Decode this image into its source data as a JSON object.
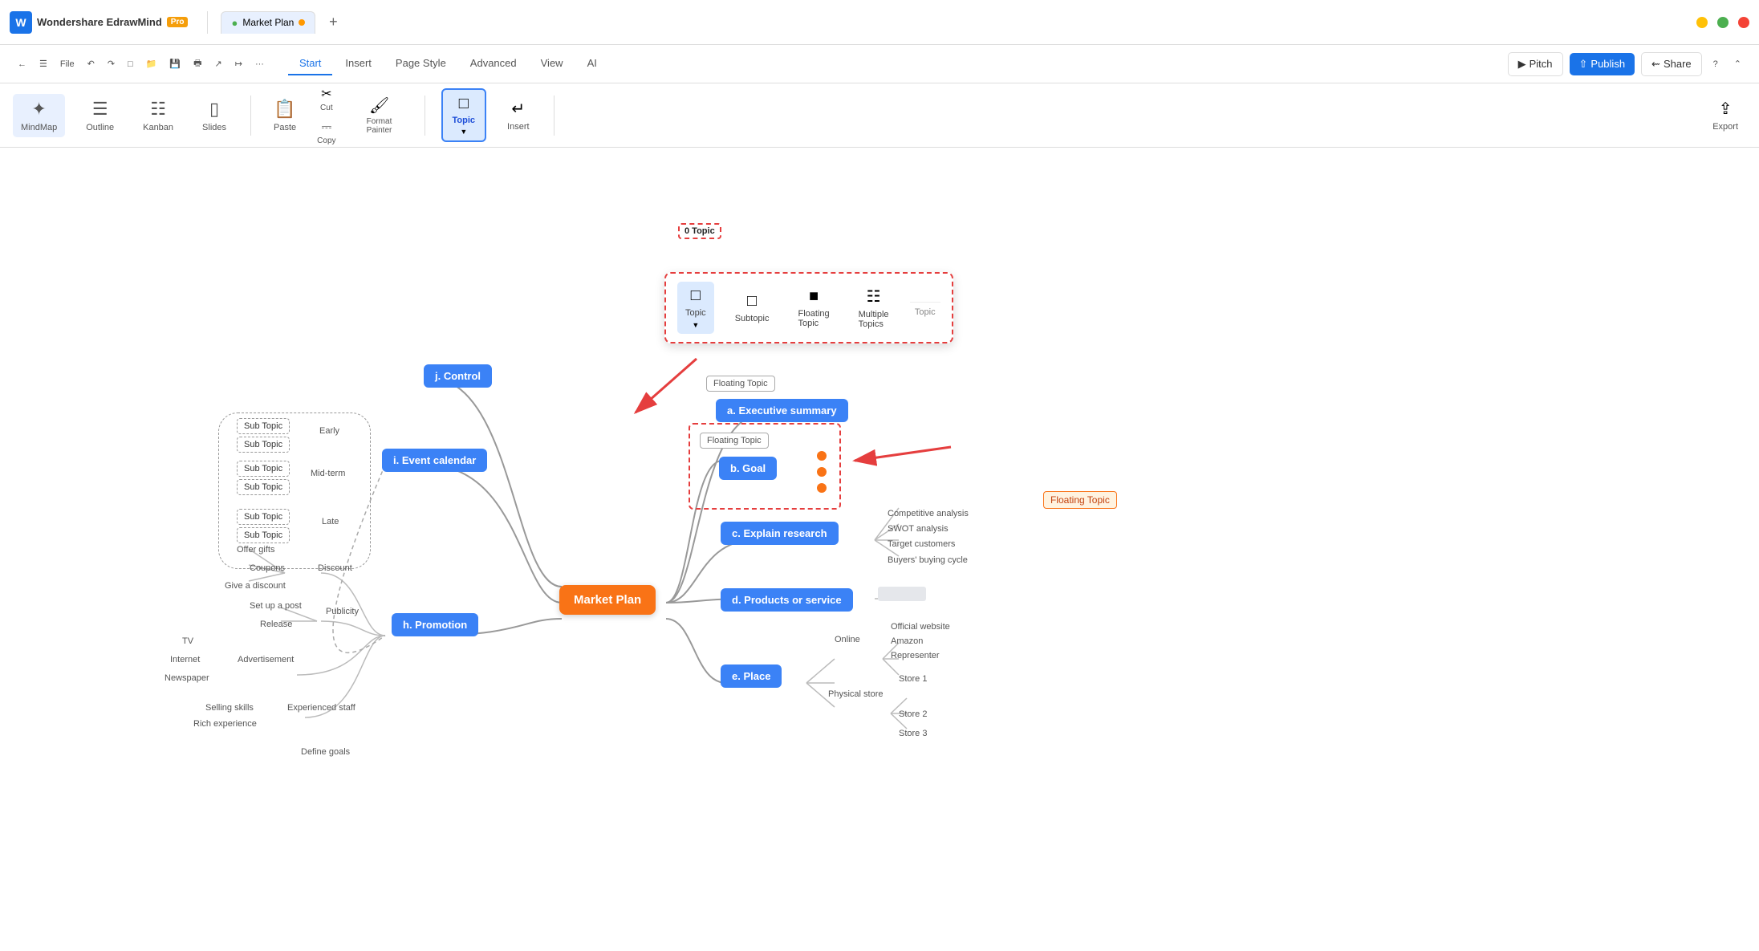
{
  "app": {
    "name": "Wondershare EdrawMind",
    "pro_badge": "Pro",
    "tab_title": "Market Plan",
    "logo_letter": "W"
  },
  "titlebar": {
    "min": "─",
    "max": "□",
    "close": "✕"
  },
  "menubar": {
    "tabs": [
      "Start",
      "Insert",
      "Page Style",
      "Advanced",
      "View",
      "AI"
    ],
    "active_tab": "Start",
    "pitch_label": "Pitch",
    "publish_label": "Publish",
    "share_label": "Share"
  },
  "toolbar": {
    "mindmap_label": "MindMap",
    "outline_label": "Outline",
    "kanban_label": "Kanban",
    "slides_label": "Slides",
    "paste_label": "Paste",
    "cut_label": "Cut",
    "copy_label": "Copy",
    "format_painter_label": "Format Painter",
    "topic_label": "Topic",
    "insert_label": "Insert",
    "export_label": "Export"
  },
  "topic_popup": {
    "topic_label": "Topic",
    "subtopic_label": "Subtopic",
    "floating_label": "Floating Topic",
    "multiple_label": "Multiple Topics",
    "section_label": "Topic"
  },
  "mindmap": {
    "center": "Market Plan",
    "nodes": {
      "executive_summary": "a. Executive summary",
      "goal": "b. Goal",
      "explain_research": "c. Explain research",
      "products": "d. Products or service",
      "place": "e. Place",
      "promotion": "h. Promotion",
      "event_calendar": "i. Event calendar",
      "control": "j. Control"
    },
    "floating_topics": [
      "Floating Topic",
      "Floating Topic"
    ],
    "subitems": {
      "research": [
        "Competitive analysis",
        "SWOT analysis",
        "Target customers",
        "Buyers' buying cycle"
      ],
      "place_online": [
        "Official website",
        "Amazon",
        "Representer"
      ],
      "place_physical": [
        "Store 1",
        "Store 2",
        "Store 3"
      ],
      "promotion_discount": [
        "Offer gifts",
        "Coupons",
        "Give a  discount"
      ],
      "promotion_publicity": [
        "Set up a post",
        "Release"
      ],
      "promotion_advertisement": [
        "TV",
        "Internet",
        "Newspaper"
      ],
      "promotion_staff": [
        "Selling skills",
        "Rich experience"
      ],
      "event_early": [
        "Sub Topic",
        "Sub Topic"
      ],
      "event_mid": [
        "Sub Topic",
        "Sub Topic"
      ],
      "event_late": [
        "Sub Topic",
        "Sub Topic"
      ],
      "control": [
        "Define goals"
      ]
    },
    "branch_labels": {
      "early": "Early",
      "midterm": "Mid-term",
      "late": "Late",
      "discount": "Discount",
      "publicity": "Publicity",
      "advertisement": "Advertisement",
      "experienced_staff": "Experienced staff",
      "online": "Online",
      "physical_store": "Physical store"
    }
  }
}
